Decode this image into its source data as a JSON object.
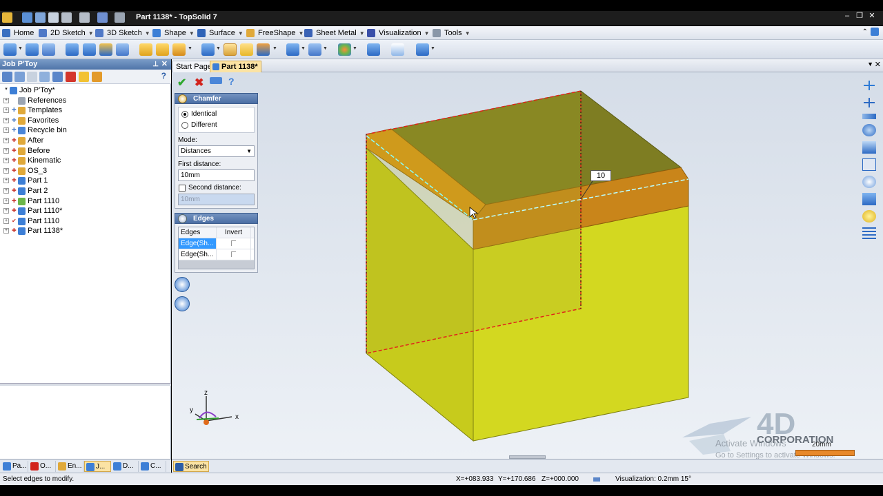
{
  "window": {
    "title": "Part 1138* - TopSolid 7"
  },
  "menu": [
    {
      "label": "Home",
      "icon": "home-icon"
    },
    {
      "label": "2D Sketch",
      "icon": "sketch-2d-icon"
    },
    {
      "label": "3D Sketch",
      "icon": "sketch-3d-icon"
    },
    {
      "label": "Shape",
      "icon": "shape-icon"
    },
    {
      "label": "Surface",
      "icon": "surface-icon"
    },
    {
      "label": "FreeShape",
      "icon": "freeshape-icon"
    },
    {
      "label": "Sheet Metal",
      "icon": "sheet-metal-icon"
    },
    {
      "label": "Visualization",
      "icon": "visualization-icon"
    },
    {
      "label": "Tools",
      "icon": "tools-icon"
    }
  ],
  "left_panel": {
    "title": "Job P'Toy",
    "help": "?",
    "tree": [
      {
        "label": "Job P'Toy*",
        "expander": "",
        "bullet": ""
      },
      {
        "label": "References",
        "expander": "+",
        "bullet": ""
      },
      {
        "label": "Templates",
        "expander": "+",
        "bullet": "blue"
      },
      {
        "label": "Favorites",
        "expander": "+",
        "bullet": "blue"
      },
      {
        "label": "Recycle bin",
        "expander": "+",
        "bullet": "blue"
      },
      {
        "label": "After",
        "expander": "+",
        "bullet": "red"
      },
      {
        "label": "Before",
        "expander": "+",
        "bullet": "red"
      },
      {
        "label": "Kinematic",
        "expander": "+",
        "bullet": "red"
      },
      {
        "label": "OS_3",
        "expander": "+",
        "bullet": "red"
      },
      {
        "label": "Part 1",
        "expander": "+",
        "bullet": "red"
      },
      {
        "label": "Part 2",
        "expander": "+",
        "bullet": "red"
      },
      {
        "label": "Part 1110",
        "expander": "+",
        "bullet": "red"
      },
      {
        "label": "Part 1110*",
        "expander": "+",
        "bullet": "red"
      },
      {
        "label": "Part 1110",
        "expander": "+",
        "bullet": "check"
      },
      {
        "label": "Part 1138*",
        "expander": "+",
        "bullet": "red"
      }
    ]
  },
  "bottom_tabs": [
    {
      "label": "Pa..."
    },
    {
      "label": "O..."
    },
    {
      "label": "En..."
    },
    {
      "label": "J...",
      "active": true
    },
    {
      "label": "D..."
    },
    {
      "label": "C..."
    }
  ],
  "search_tab": {
    "label": "Search"
  },
  "doc_tabs": [
    {
      "label": "Start Page"
    },
    {
      "label": "Part 1138*",
      "active": true
    }
  ],
  "chamfer": {
    "title": "Chamfer",
    "options": [
      "Identical",
      "Different"
    ],
    "selected_option": "Identical",
    "mode_label": "Mode:",
    "mode_value": "Distances",
    "first_distance_label": "First distance:",
    "first_distance_value": "10mm",
    "second_distance_label": "Second distance:",
    "second_distance_value": "10mm"
  },
  "edges": {
    "title": "Edges",
    "headers": [
      "Edges",
      "Invert"
    ],
    "rows": [
      {
        "edge": "Edge(Sh...",
        "invert": "",
        "selected": true
      },
      {
        "edge": "Edge(Sh...",
        "invert": "",
        "selected": false
      }
    ]
  },
  "viewport": {
    "dimension_label": "10",
    "axis": {
      "x": "x",
      "y": "y",
      "z": "z"
    },
    "scale_label": "20mm",
    "watermark_brand": "4D",
    "watermark_sub": "CORPORATION",
    "activate_line1": "Activate Windows",
    "activate_line2": "Go to Settings to activate Windows."
  },
  "status": {
    "hint": "Select edges to modify.",
    "x": "X=+083.933",
    "y": "Y=+170.686",
    "z": "Z=+000.000",
    "visualization": "Visualization: 0.2mm 15°"
  },
  "colors": {
    "face_yellow": "#cdd21d",
    "chamfer_orange": "#d99216",
    "selection_red": "#e0241a",
    "accent": "#fbe3a4"
  }
}
